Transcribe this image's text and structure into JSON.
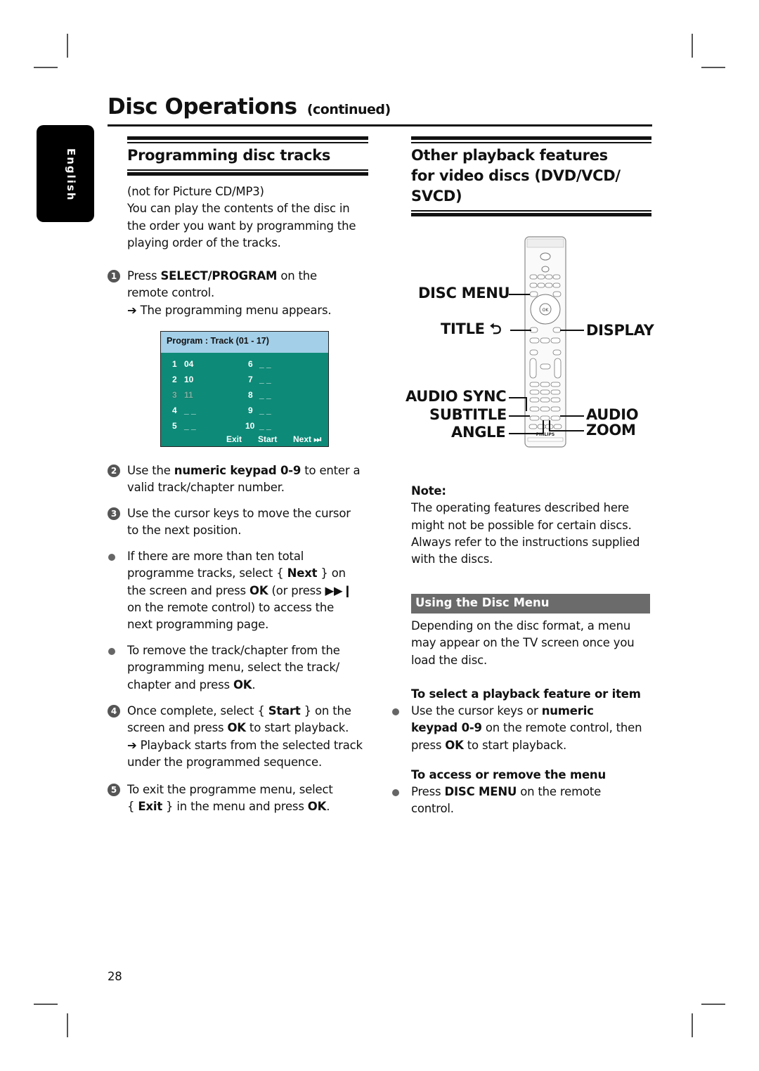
{
  "page": {
    "title": "Disc Operations",
    "title_suffix": "(continued)",
    "language_tab": "English",
    "page_number": "28"
  },
  "left": {
    "heading": "Programming disc tracks",
    "intro_line1": "(not for Picture CD/MP3)",
    "intro_lines": [
      "You can play the contents of the disc in",
      "the order you want by programming the",
      "playing order of the tracks."
    ],
    "steps": [
      {
        "num": "1",
        "lines": [
          [
            "Press ",
            "SELECT/PROGRAM",
            " on the"
          ],
          [
            "remote control."
          ]
        ],
        "result": "The programming menu appears."
      },
      {
        "num": "2",
        "lines": [
          [
            "Use the ",
            "numeric keypad 0-9",
            " to enter a"
          ],
          [
            "valid track/chapter number."
          ]
        ]
      },
      {
        "num": "3",
        "lines": [
          [
            "Use the cursor keys to move the cursor"
          ],
          [
            "to the next position."
          ]
        ]
      }
    ],
    "bullets": [
      {
        "lines": [
          [
            "If there are more than ten total"
          ],
          [
            "programme tracks, select { ",
            "Next",
            " } on"
          ],
          [
            "the screen and press ",
            "OK",
            " (or press ▶▶❙"
          ],
          [
            "on the remote control) to access the"
          ],
          [
            "next programming page."
          ]
        ]
      },
      {
        "lines": [
          [
            "To remove the track/chapter from the"
          ],
          [
            "programming menu, select the track/"
          ],
          [
            "chapter and press ",
            "OK",
            "."
          ]
        ]
      }
    ],
    "steps2": [
      {
        "num": "4",
        "lines": [
          [
            "Once complete, select { ",
            "Start",
            " } on the"
          ],
          [
            "screen and press ",
            "OK",
            " to start playback."
          ]
        ],
        "result_lines": [
          "Playback starts from the selected track",
          "under the programmed sequence."
        ]
      },
      {
        "num": "5",
        "lines": [
          [
            "To exit the programme menu, select"
          ],
          [
            "{ ",
            "Exit",
            " } in the menu and press ",
            "OK",
            "."
          ]
        ]
      }
    ],
    "arrow_glyph": "➔"
  },
  "program_screen": {
    "header": "Program : Track (01 - 17)",
    "slots": [
      {
        "n": "1",
        "v": "04",
        "selected": false
      },
      {
        "n": "2",
        "v": "10",
        "selected": false
      },
      {
        "n": "3",
        "v": "11",
        "selected": true
      },
      {
        "n": "4",
        "v": "_ _",
        "selected": false
      },
      {
        "n": "5",
        "v": "_ _",
        "selected": false
      },
      {
        "n": "6",
        "v": "_ _",
        "selected": false
      },
      {
        "n": "7",
        "v": "_ _",
        "selected": false
      },
      {
        "n": "8",
        "v": "_ _",
        "selected": false
      },
      {
        "n": "9",
        "v": "_ _",
        "selected": false
      },
      {
        "n": "10",
        "v": "_ _",
        "selected": false
      }
    ],
    "footer": {
      "exit": "Exit",
      "start": "Start",
      "next": "Next ⏭"
    },
    "colors": {
      "header_bg": "#a3cfe8",
      "body_bg": "#0e8a78"
    }
  },
  "right": {
    "heading_lines": [
      "Other playback features",
      "for video discs (DVD/VCD/",
      "SVCD)"
    ],
    "remote_labels": {
      "disc_menu": "DISC MENU",
      "title": "TITLE ⮌",
      "display": "DISPLAY",
      "audio_sync": "AUDIO SYNC",
      "subtitle": "SUBTITLE",
      "audio": "AUDIO",
      "angle": "ANGLE",
      "zoom": "ZOOM"
    },
    "remote_brand": "PHILIPS",
    "note_label": "Note:",
    "note_lines": [
      "The operating features described here",
      "might not be possible for certain discs.",
      "Always refer to the instructions supplied",
      "with the discs."
    ],
    "section_band": "Using the Disc Menu",
    "section_band_color": "#6b6b6b",
    "disc_menu_lines": [
      "Depending on the disc format, a menu",
      "may appear on the TV screen once you",
      "load the disc."
    ],
    "sub1_heading": "To select a playback feature or item",
    "sub1_lines": [
      [
        "Use the cursor keys or ",
        "numeric"
      ],
      [
        "",
        "keypad 0-9",
        " on the remote control, then"
      ],
      [
        "press ",
        "OK",
        " to start playback."
      ]
    ],
    "sub2_heading": "To access or remove the menu",
    "sub2_lines": [
      [
        "Press ",
        "DISC MENU",
        " on the remote"
      ],
      [
        "control."
      ]
    ]
  }
}
